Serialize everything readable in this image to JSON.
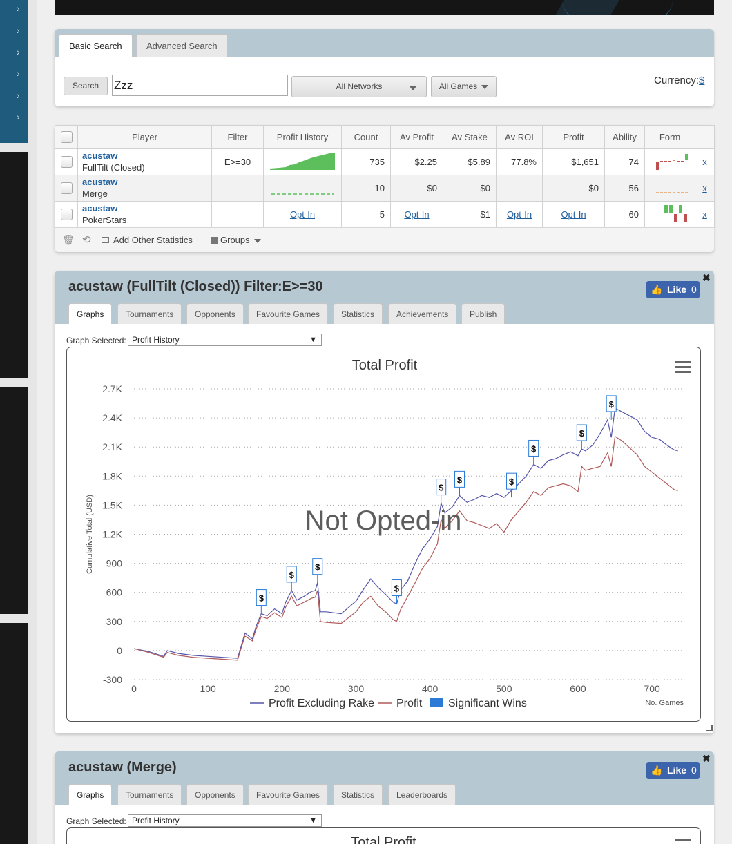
{
  "search": {
    "tabs": [
      "Basic Search",
      "Advanced Search"
    ],
    "search_button": "Search",
    "query": "Zzz",
    "networks": "All Networks",
    "games": "All Games",
    "currency_label": "Currency:",
    "currency_value": "$"
  },
  "table": {
    "headers": [
      "Player",
      "Filter",
      "Profit History",
      "Count",
      "Av Profit",
      "Av Stake",
      "Av ROI",
      "Profit",
      "Ability",
      "Form"
    ],
    "rows": [
      {
        "player": "acustaw",
        "network": "FullTilt (Closed)",
        "filter": "E>=30",
        "count": "735",
        "av_profit": "$2.25",
        "av_stake": "$5.89",
        "av_roi": "77.8%",
        "profit": "$1,651",
        "ability": "74",
        "remove": "x"
      },
      {
        "player": "acustaw",
        "network": "Merge",
        "filter": "",
        "count": "10",
        "av_profit": "$0",
        "av_stake": "$0",
        "av_roi": "-",
        "profit": "$0",
        "ability": "56",
        "remove": "x"
      },
      {
        "player": "acustaw",
        "network": "PokerStars",
        "filter": "",
        "profit_history": "Opt-In",
        "count": "5",
        "av_profit": "Opt-In",
        "av_stake": "$1",
        "av_roi": "Opt-In",
        "profit": "Opt-In",
        "ability": "60",
        "remove": "x"
      }
    ],
    "footer": {
      "add_stats": "Add Other Statistics",
      "groups": "Groups"
    }
  },
  "panel1": {
    "title": "acustaw (FullTilt (Closed)) Filter:E>=30",
    "like_label": "Like",
    "like_count": "0",
    "tabs": [
      "Graphs",
      "Tournaments",
      "Opponents",
      "Favourite Games",
      "Statistics",
      "Achievements",
      "Publish"
    ],
    "graph_label": "Graph Selected:",
    "graph_value": "Profit History"
  },
  "panel2": {
    "title": "acustaw (Merge)",
    "like_label": "Like",
    "like_count": "0",
    "tabs": [
      "Graphs",
      "Tournaments",
      "Opponents",
      "Favourite Games",
      "Statistics",
      "Leaderboards"
    ],
    "graph_label": "Graph Selected:",
    "graph_value": "Profit History",
    "chart_title": "Total Profit"
  },
  "chart_data": {
    "type": "line",
    "title": "Total Profit",
    "xlabel": "No. Games",
    "ylabel": "Cumulative Total (USD)",
    "watermark": "Not Opted-in",
    "xlim": [
      0,
      740
    ],
    "ylim": [
      -300,
      2700
    ],
    "xticks": [
      0,
      100,
      200,
      300,
      400,
      500,
      600,
      700
    ],
    "yticks": [
      -300,
      0,
      300,
      600,
      900,
      1200,
      1500,
      1800,
      2100,
      2400,
      2700
    ],
    "ytick_labels": [
      "-300",
      "0",
      "300",
      "600",
      "900",
      "1.2K",
      "1.5K",
      "1.8K",
      "2.1K",
      "2.4K",
      "2.7K"
    ],
    "grid": true,
    "legend_position": "bottom",
    "series": [
      {
        "name": "Profit Excluding Rake",
        "color": "#5555aa",
        "x": [
          0,
          20,
          40,
          45,
          60,
          80,
          100,
          120,
          140,
          145,
          150,
          160,
          165,
          172,
          180,
          190,
          200,
          205,
          213,
          220,
          230,
          240,
          245,
          248,
          252,
          260,
          280,
          300,
          310,
          320,
          330,
          340,
          350,
          355,
          360,
          370,
          380,
          390,
          400,
          410,
          415,
          420,
          430,
          440,
          450,
          460,
          470,
          480,
          490,
          500,
          510,
          520,
          530,
          540,
          550,
          560,
          570,
          580,
          590,
          600,
          605,
          610,
          620,
          630,
          640,
          645,
          650,
          660,
          670,
          680,
          690,
          700,
          710,
          720,
          730,
          735
        ],
        "y": [
          20,
          -10,
          -60,
          0,
          -30,
          -50,
          -60,
          -70,
          -80,
          50,
          180,
          120,
          250,
          380,
          360,
          430,
          380,
          500,
          620,
          520,
          560,
          610,
          620,
          700,
          400,
          400,
          380,
          510,
          630,
          740,
          650,
          580,
          500,
          480,
          620,
          720,
          900,
          1050,
          1150,
          1280,
          1520,
          1420,
          1480,
          1600,
          1530,
          1560,
          1600,
          1580,
          1620,
          1580,
          1650,
          1720,
          1800,
          1920,
          1880,
          1960,
          1980,
          2020,
          2050,
          2010,
          2080,
          2060,
          2120,
          2240,
          2380,
          2200,
          2500,
          2460,
          2420,
          2380,
          2260,
          2200,
          2180,
          2120,
          2070,
          2060
        ]
      },
      {
        "name": "Profit",
        "color": "#b05a5a",
        "x": [
          0,
          20,
          40,
          45,
          60,
          80,
          100,
          120,
          140,
          145,
          150,
          160,
          165,
          172,
          180,
          190,
          200,
          205,
          213,
          220,
          230,
          240,
          245,
          248,
          252,
          260,
          280,
          300,
          310,
          320,
          330,
          340,
          350,
          355,
          360,
          370,
          380,
          390,
          400,
          410,
          415,
          420,
          430,
          440,
          450,
          460,
          470,
          480,
          490,
          500,
          510,
          520,
          530,
          540,
          550,
          560,
          570,
          580,
          590,
          600,
          605,
          610,
          620,
          630,
          640,
          645,
          650,
          660,
          670,
          680,
          690,
          700,
          710,
          720,
          730,
          735
        ],
        "y": [
          20,
          -20,
          -70,
          -20,
          -50,
          -70,
          -80,
          -90,
          -100,
          30,
          150,
          100,
          220,
          350,
          330,
          390,
          340,
          450,
          560,
          460,
          500,
          540,
          550,
          620,
          300,
          290,
          280,
          400,
          500,
          560,
          460,
          400,
          320,
          300,
          420,
          560,
          700,
          850,
          950,
          1100,
          1350,
          1260,
          1340,
          1440,
          1340,
          1320,
          1290,
          1260,
          1310,
          1220,
          1350,
          1440,
          1530,
          1640,
          1600,
          1680,
          1700,
          1720,
          1700,
          1640,
          1900,
          1860,
          1880,
          1900,
          2040,
          1900,
          2210,
          2160,
          2090,
          2020,
          1900,
          1840,
          1780,
          1720,
          1660,
          1650
        ]
      },
      {
        "name": "Significant Wins",
        "color": "#2a7ad6",
        "type": "flag",
        "x": [
          172,
          213,
          248,
          355,
          415,
          440,
          510,
          540,
          605,
          645
        ],
        "y": [
          380,
          620,
          700,
          480,
          1520,
          1600,
          1580,
          1920,
          2080,
          2380
        ],
        "label": "$"
      }
    ]
  },
  "legend_colors": {
    "profit_excl": "#5555aa",
    "profit": "#b05a5a",
    "wins": "#2a7ad6"
  }
}
